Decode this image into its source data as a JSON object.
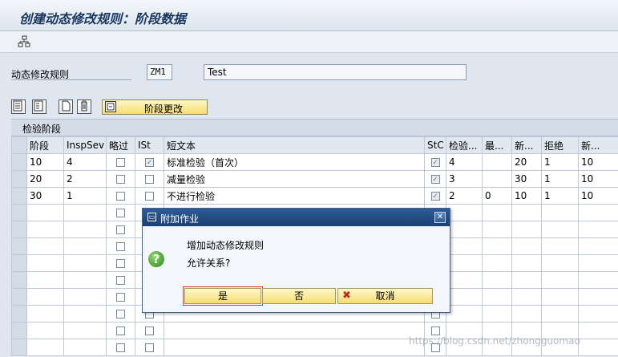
{
  "window": {
    "title": "创建动态修改规则：阶段数据"
  },
  "form": {
    "rule_label": "动态修改规则",
    "rule_code": "ZM1",
    "rule_desc": "Test"
  },
  "buttons": {
    "stage_change": "阶段更改"
  },
  "grid": {
    "title": "检验阶段",
    "columns": [
      "阶段",
      "InspSev",
      "略过",
      "ISt",
      "短文本",
      "StC",
      "检验...",
      "最...",
      "新...",
      "拒绝",
      "新..."
    ],
    "rows": [
      {
        "stage": "10",
        "insp_sev": "4",
        "skip": false,
        "ist": true,
        "text": "标准检验（首次）",
        "stc": true,
        "insp": "4",
        "max": "",
        "new1": "20",
        "reject": "1",
        "new2": "10"
      },
      {
        "stage": "20",
        "insp_sev": "2",
        "skip": false,
        "ist": false,
        "text": "减量检验",
        "stc": true,
        "insp": "3",
        "max": "",
        "new1": "30",
        "reject": "1",
        "new2": "10"
      },
      {
        "stage": "30",
        "insp_sev": "1",
        "skip": false,
        "ist": false,
        "text": "不进行检验",
        "stc": true,
        "insp": "2",
        "max": "0",
        "new1": "10",
        "reject": "1",
        "new2": "10"
      }
    ]
  },
  "dialog": {
    "title": "附加作业",
    "message1": "增加动态修改规则",
    "message2": "允许关系?",
    "yes": "是",
    "no": "否",
    "cancel": "取消"
  },
  "watermark": "https://blog.csdn.net/zhongguomao",
  "icons": {
    "toolbar": "hierarchy-icon",
    "question": "question-icon"
  },
  "colors": {
    "dialog_header": "#1b3f73",
    "button_yellow": "#f5dd6f",
    "question_green": "#2c8a1c"
  }
}
